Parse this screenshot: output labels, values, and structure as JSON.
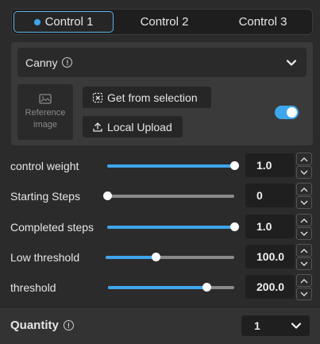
{
  "tabs": [
    {
      "label": "Control 1",
      "active": true
    },
    {
      "label": "Control 2",
      "active": false
    },
    {
      "label": "Control 3",
      "active": false
    }
  ],
  "preprocessor": {
    "selected": "Canny"
  },
  "reference_image": {
    "line1": "Reference",
    "line2": "image"
  },
  "buttons": {
    "from_selection": "Get from selection",
    "local_upload": "Local Upload"
  },
  "toggle": {
    "enabled": true
  },
  "sliders": [
    {
      "label": "control weight",
      "value": "1.0",
      "fraction": 1.0
    },
    {
      "label": "Starting Steps",
      "value": "0",
      "fraction": 0.0
    },
    {
      "label": "Completed steps",
      "value": "1.0",
      "fraction": 1.0
    },
    {
      "label": "Low threshold",
      "value": "100.0",
      "fraction": 0.39
    },
    {
      "label": "threshold",
      "value": "200.0",
      "fraction": 0.78
    }
  ],
  "quantity": {
    "label": "Quantity",
    "value": "1"
  },
  "colors": {
    "accent": "#3ea6ec",
    "background": "#2b2b2b",
    "panel": "#3a3a3a"
  }
}
